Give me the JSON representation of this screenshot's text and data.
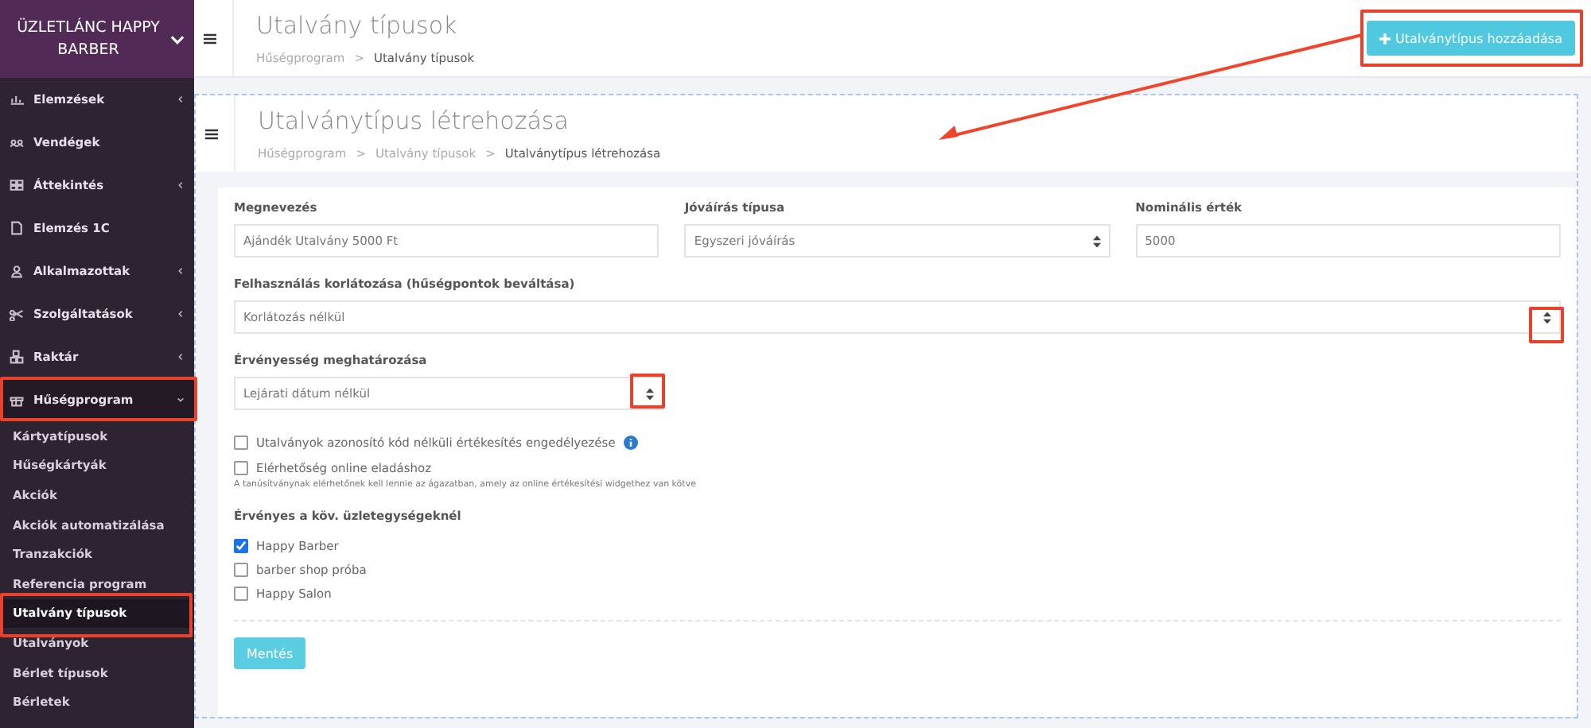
{
  "brand": {
    "name": "ÜZLETLÁNC HAPPY BARBER"
  },
  "sidebar": {
    "items": [
      {
        "label": "Elemzések",
        "has_submenu": true,
        "expanded": false
      },
      {
        "label": "Vendégek",
        "has_submenu": false
      },
      {
        "label": "Áttekintés",
        "has_submenu": true,
        "expanded": false
      },
      {
        "label": "Elemzés 1C",
        "has_submenu": false
      },
      {
        "label": "Alkalmazottak",
        "has_submenu": true,
        "expanded": false
      },
      {
        "label": "Szolgáltatások",
        "has_submenu": true,
        "expanded": false
      },
      {
        "label": "Raktár",
        "has_submenu": true,
        "expanded": false
      },
      {
        "label": "Hűségprogram",
        "has_submenu": true,
        "expanded": true,
        "children": [
          {
            "label": "Kártyatípusok",
            "selected": false
          },
          {
            "label": "Hűségkártyák",
            "selected": false
          },
          {
            "label": "Akciók",
            "selected": false
          },
          {
            "label": "Akciók automatizálása",
            "selected": false
          },
          {
            "label": "Tranzakciók",
            "selected": false
          },
          {
            "label": "Referencia program",
            "selected": false
          },
          {
            "label": "Utalvány típusok",
            "selected": true
          },
          {
            "label": "Utalványok",
            "selected": false
          },
          {
            "label": "Bérlet típusok",
            "selected": false
          },
          {
            "label": "Bérletek",
            "selected": false
          }
        ]
      }
    ]
  },
  "page_header": {
    "title": "Utalvány típusok",
    "breadcrumb": [
      "Hűségprogram",
      "Utalvány típusok"
    ],
    "separator": ">",
    "add_button": "Utalványtípus hozzáadása"
  },
  "create_header": {
    "title": "Utalványtípus létrehozása",
    "breadcrumb": [
      "Hűségprogram",
      "Utalvány típusok",
      "Utalványtípus létrehozása"
    ],
    "separator": ">"
  },
  "form": {
    "name": {
      "label": "Megnevezés",
      "value": "Ajándék Utalvány 5000 Ft"
    },
    "credit_type": {
      "label": "Jóváírás típusa",
      "value": "Egyszeri jóváírás"
    },
    "nominal": {
      "label": "Nominális érték",
      "value": "5000"
    },
    "usage_limit": {
      "label": "Felhasználás korlátozása (hűségpontok beváltása)",
      "value": "Korlátozás nélkül"
    },
    "validity": {
      "label": "Érvényesség meghatározása",
      "value": "Lejárati dátum nélkül"
    },
    "options": [
      {
        "label": "Utalványok azonosító kód nélküli értékesítés engedélyezése",
        "checked": false,
        "info": true
      },
      {
        "label": "Elérhetőség online eladáshoz",
        "checked": false,
        "info": false,
        "hint": "A tanúsítványnak elérhetőnek kell lennie az ágazatban, amely az online értékesítési widgethez van kötve"
      }
    ],
    "stores_label": "Érvényes a köv. üzletegységeknél",
    "stores": [
      {
        "label": "Happy Barber",
        "checked": true
      },
      {
        "label": "barber shop próba",
        "checked": false
      },
      {
        "label": "Happy Salon",
        "checked": false
      }
    ],
    "save_button": "Mentés"
  }
}
